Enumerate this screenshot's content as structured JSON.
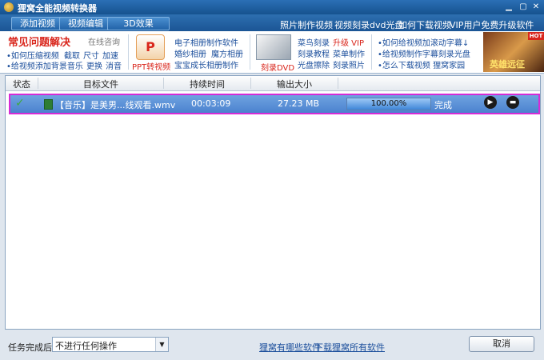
{
  "window": {
    "title": "狸窝全能视频转换器"
  },
  "toolbar": {
    "add_video": "添加视频",
    "edit_video": "视频编辑",
    "effect_3d": "3D效果",
    "links": [
      "照片制作视频",
      "视频刻录dvd光盘",
      "如何下载视频",
      "VIP用户免费升级软件"
    ]
  },
  "banner": {
    "faq_title": "常见问题解决",
    "faq_online": "在线咨询",
    "faq_links": [
      [
        "•如何压缩视频",
        "截取",
        "尺寸",
        "加速"
      ],
      [
        "•给视频添加背景音乐",
        "更换",
        "消音"
      ]
    ],
    "ppt_caption": "PPT转视频",
    "album_links": [
      [
        "电子相册制作软件"
      ],
      [
        "婚纱相册",
        "魔方相册"
      ],
      [
        "宝宝成长相册制作"
      ]
    ],
    "dvd_caption": "刻录DVD",
    "dvd_links": [
      [
        "菜鸟刻录",
        "升级 VIP"
      ],
      [
        "刻录教程",
        "菜单制作"
      ],
      [
        "光盘擦除",
        "刻录照片"
      ]
    ],
    "tip_links": [
      "•如何给视频加滚动字幕↓",
      "•给视频制作字幕刻录光盘",
      "•怎么下载视频   狸窝家园"
    ],
    "ad_text": "英雄远征",
    "ad_badge": "HOT"
  },
  "table": {
    "headers": [
      "状态",
      "目标文件",
      "持续时间",
      "输出大小"
    ],
    "rows": [
      {
        "status_icon": "check-icon",
        "file": "【音乐】是美男...线观看.wmv",
        "duration": "00:03:09",
        "size": "27.23 MB",
        "progress": 100,
        "progress_label": "100.00%",
        "state": "完成"
      }
    ]
  },
  "footer": {
    "after_label": "任务完成后:",
    "after_value": "不进行任何操作",
    "link1": "狸窝有哪些软件",
    "link2": "下载狸窝所有软件",
    "cancel": "取消"
  }
}
